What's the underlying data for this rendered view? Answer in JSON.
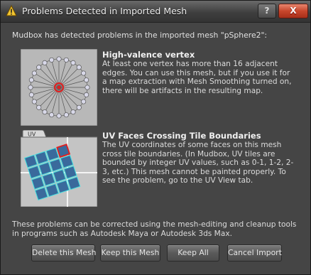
{
  "window": {
    "title": "Problems Detected in Imported Mesh",
    "help_label": "?",
    "close_label": "X"
  },
  "intro": "Mudbox has detected problems in the imported mesh \"pSphere2\":",
  "problems": [
    {
      "heading": "High-valence vertex",
      "description": "At least one vertex has more than 16 adjacent edges. You can use this mesh, but if you use it for a map extraction with Mesh Smoothing turned on, there will be artifacts in the resulting map.",
      "icon": "high-valence-vertex-diagram"
    },
    {
      "heading": "UV Faces Crossing Tile Boundaries",
      "description": "The UV coordinates of some faces on this mesh cross tile boundaries. (In Mudbox, UV tiles are bounded by integer UV values, such as 0-1, 1-2, 2-3, etc.) This mesh cannot be painted properly. To see the problem, go to the UV View tab.",
      "icon": "uv-tile-diagram",
      "thumb_tab": "UV"
    }
  ],
  "footer": "These problems can be corrected using the mesh-editing and cleanup tools in programs such as Autodesk Maya or Autodesk 3ds Max.",
  "buttons": {
    "delete": "Delete this Mesh",
    "keep": "Keep this Mesh",
    "keep_all": "Keep All",
    "cancel": "Cancel Import"
  },
  "colors": {
    "close_red": "#c8462c",
    "highlight_red": "#e02020",
    "uv_blue": "#3a6a9c",
    "uv_outline": "#40e0e0"
  }
}
